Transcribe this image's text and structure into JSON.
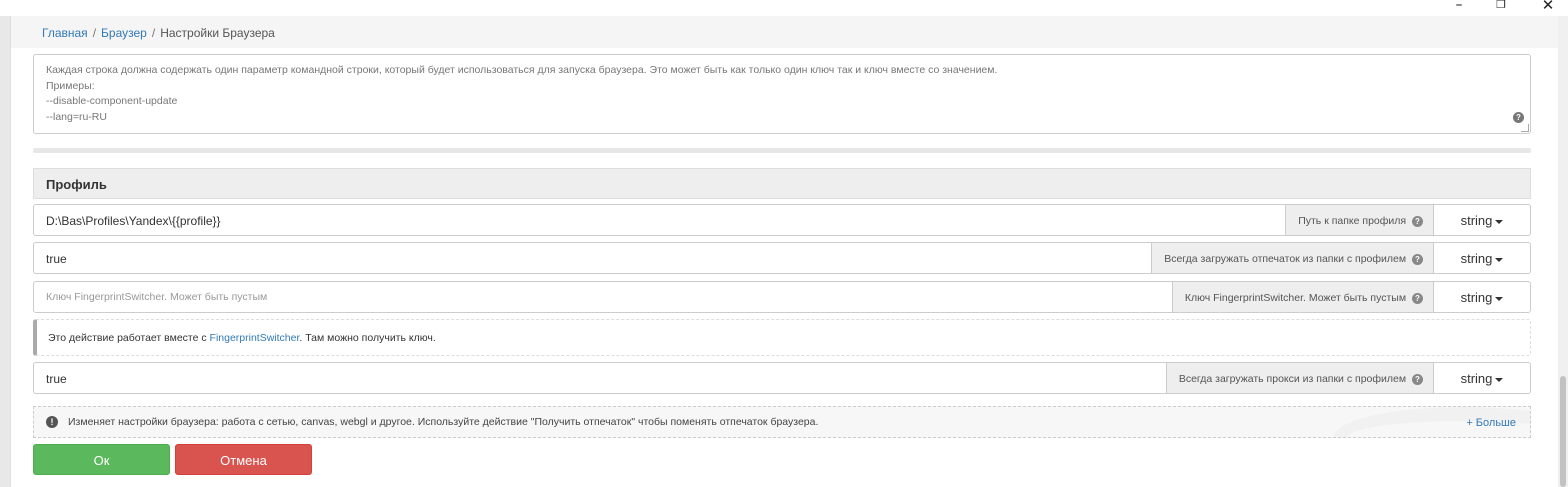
{
  "window": {
    "minimize": "–",
    "maximize": "❐",
    "close": "✕"
  },
  "breadcrumb": {
    "home": "Главная",
    "sep": "/",
    "browser": "Браузер",
    "current": "Настройки Браузера"
  },
  "command_line": {
    "placeholder_lines": [
      "Каждая строка должна содержать один параметр командной строки, который будет использоваться для запуска браузера. Это может быть как только один ключ так и ключ вместе со значением.",
      "Примеры:",
      "--disable-component-update",
      "--lang=ru-RU"
    ],
    "help": "?"
  },
  "profile_section": {
    "title": "Профиль",
    "fields": [
      {
        "value": "D:\\Bas\\Profiles\\Yandex\\{{profile}}",
        "label": "Путь к папке профиля",
        "type": "string"
      },
      {
        "value": "true",
        "label": "Всегда загружать отпечаток из папки с профилем",
        "type": "string"
      },
      {
        "placeholder": "Ключ FingerprintSwitcher. Может быть пустым",
        "label": "Ключ FingerprintSwitcher. Может быть пустым",
        "type": "string"
      },
      {
        "value": "true",
        "label": "Всегда загружать прокси из папки с профилем",
        "type": "string"
      }
    ],
    "note": {
      "before": "Это действие работает вместе с ",
      "link": "FingerprintSwitcher",
      "after": ". Там можно получить ключ."
    }
  },
  "description": {
    "icon": "!",
    "text": "Изменяет настройки браузера: работа с сетью, canvas, webgl и другое. Используйте действие \"Получить отпечаток\" чтобы поменять отпечаток браузера.",
    "more": "+ Больше"
  },
  "buttons": {
    "ok": "Ок",
    "cancel": "Отмена"
  },
  "help_icon": "?",
  "colors": {
    "ok": "#5cb85c",
    "cancel": "#d9534f",
    "link": "#337ab7"
  }
}
